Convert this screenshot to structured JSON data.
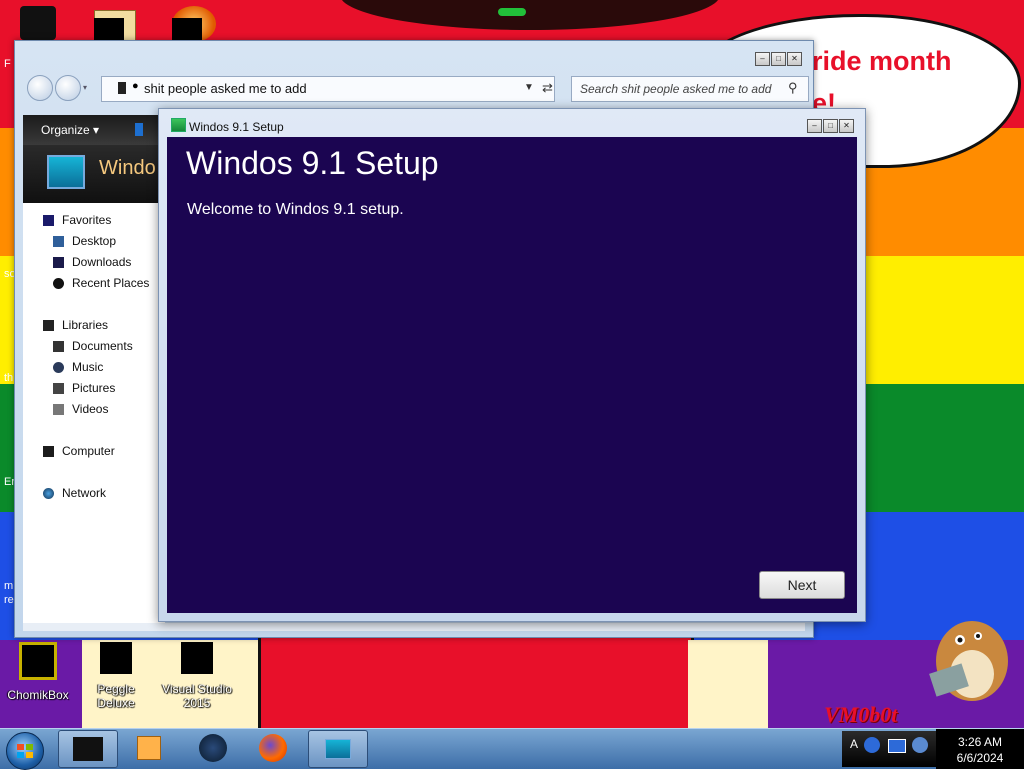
{
  "desktop": {
    "cloud_line1": "ride month",
    "cloud_line2": "e!",
    "left_fragments": [
      "F",
      "so",
      "th",
      "Er",
      "m",
      "re"
    ],
    "icons": [
      {
        "label": "ChomikBox"
      },
      {
        "label": "Peggle Deluxe"
      },
      {
        "label": "Visual Studio 2015"
      }
    ],
    "watermark": "VM0b0t"
  },
  "explorer": {
    "address_path": "shit people asked me to add",
    "search_placeholder": "Search shit people asked me to add",
    "toolbar": {
      "organize": "Organize ▾"
    },
    "folder_title": "Windo",
    "nav": {
      "favorites": "Favorites",
      "desktop": "Desktop",
      "downloads": "Downloads",
      "recent_places": "Recent Places",
      "libraries": "Libraries",
      "documents": "Documents",
      "music": "Music",
      "pictures": "Pictures",
      "videos": "Videos",
      "computer": "Computer",
      "network": "Network"
    }
  },
  "setup": {
    "window_title": "Windos 9.1 Setup",
    "heading": "Windos 9.1 Setup",
    "welcome": "Welcome to Windos 9.1 setup.",
    "next_label": "Next"
  },
  "taskbar": {
    "clock_time": "3:26 AM",
    "clock_date": "6/6/2024",
    "tray_letter": "A"
  },
  "colors": {
    "setup_background": "#1b0551",
    "rainbow": [
      "#e8102a",
      "#ff8c00",
      "#ffee00",
      "#0a8a2a",
      "#1e4fe6",
      "#6a1aa6"
    ]
  }
}
